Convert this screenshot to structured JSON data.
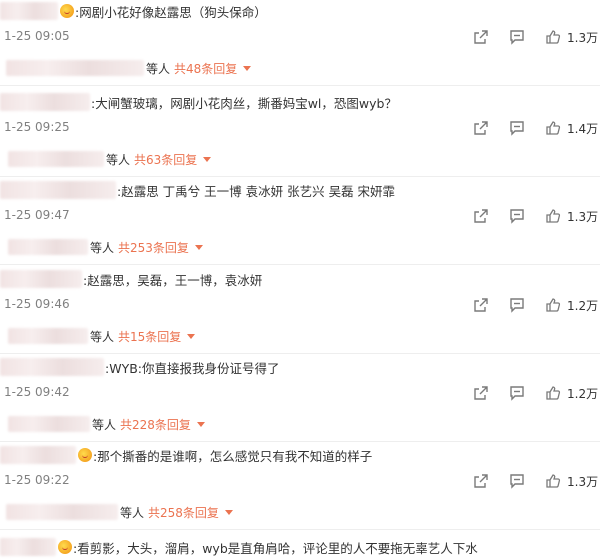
{
  "comments": [
    {
      "text": ":网剧小花好像赵露思（狗头保命）",
      "time": "1-25 09:05",
      "likes": "1.3万",
      "reply_suffix": "等人",
      "reply_link": "共48条回复",
      "has_badge": true
    },
    {
      "text": ":大闸蟹玻璃，网剧小花肉丝，撕番妈宝wl，恐图wyb？",
      "time": "1-25 09:25",
      "likes": "1.4万",
      "reply_suffix": "等人",
      "reply_link": "共63条回复",
      "has_badge": false
    },
    {
      "text": ":赵露思 丁禹兮 王一博 袁冰妍 张艺兴 吴磊 宋妍霏",
      "time": "1-25 09:47",
      "likes": "1.3万",
      "reply_suffix": "等人",
      "reply_link": "共253条回复",
      "has_badge": false
    },
    {
      "text": ":赵露思，吴磊，王一博，袁冰妍",
      "time": "1-25 09:46",
      "likes": "1.2万",
      "reply_suffix": "等人",
      "reply_link": "共15条回复",
      "has_badge": false
    },
    {
      "text": ":WYB:你直接报我身份证号得了",
      "time": "1-25 09:42",
      "likes": "1.2万",
      "reply_suffix": "等人",
      "reply_link": "共228条回复",
      "has_badge": false
    },
    {
      "text": ":那个撕番的是谁啊，怎么感觉只有我不知道的样子",
      "time": "1-25 09:22",
      "likes": "1.3万",
      "reply_suffix": "等人",
      "reply_link": "共258条回复",
      "has_badge": true
    },
    {
      "text": ":看剪影，大头，溜肩，wyb是直角肩哈，评论里的人不要拖无辜艺人下水",
      "has_badge": true
    }
  ],
  "icons": {
    "share": "share-icon",
    "reply": "comment-icon",
    "like": "thumbs-up-icon",
    "expand": "chevron-down-icon"
  },
  "colors": {
    "accent": "#eb7350",
    "time": "#808080",
    "icon": "#7a7a7a"
  }
}
